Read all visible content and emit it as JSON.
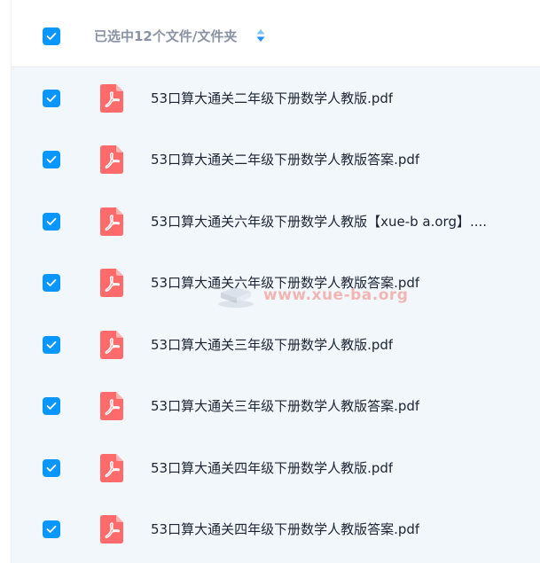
{
  "header": {
    "selection_label": "已选中12个文件/文件夹"
  },
  "colors": {
    "accent": "#0a96ff",
    "pdf_icon": "#ff6b6b",
    "list_background": "#f2f7fc"
  },
  "watermark": {
    "text": "www.xue-ba.org"
  },
  "files": [
    {
      "name": "53口算大通关二年级下册数学人教版.pdf",
      "checked": true,
      "icon": "pdf-icon"
    },
    {
      "name": "53口算大通关二年级下册数学人教版答案.pdf",
      "checked": true,
      "icon": "pdf-icon"
    },
    {
      "name": "53口算大通关六年级下册数学人教版【xue-b a.org】....",
      "checked": true,
      "icon": "pdf-icon"
    },
    {
      "name": "53口算大通关六年级下册数学人教版答案.pdf",
      "checked": true,
      "icon": "pdf-icon"
    },
    {
      "name": "53口算大通关三年级下册数学人教版.pdf",
      "checked": true,
      "icon": "pdf-icon"
    },
    {
      "name": "53口算大通关三年级下册数学人教版答案.pdf",
      "checked": true,
      "icon": "pdf-icon"
    },
    {
      "name": "53口算大通关四年级下册数学人教版.pdf",
      "checked": true,
      "icon": "pdf-icon"
    },
    {
      "name": "53口算大通关四年级下册数学人教版答案.pdf",
      "checked": true,
      "icon": "pdf-icon"
    }
  ]
}
